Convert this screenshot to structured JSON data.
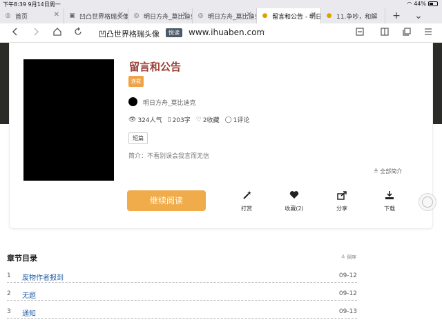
{
  "status": {
    "time": "下午8:39  9月14日周一",
    "battery_pct": "44%"
  },
  "tabs": [
    {
      "label": "首页",
      "icon": "globe-icon",
      "close": "✕"
    },
    {
      "label": "凹凸世界格瑞头像",
      "icon": "image-icon",
      "close": "✕"
    },
    {
      "label": "明日方舟_莫比迪克",
      "icon": "globe-icon",
      "close": "✕"
    },
    {
      "label": "明日方舟_莫比迪克",
      "icon": "globe-icon",
      "close": "✕"
    },
    {
      "label": "留言和公告 - 明日方舟",
      "icon": "lightbulb-icon",
      "close": "✕"
    },
    {
      "label": "11.争吵，和解",
      "icon": "lightbulb-icon",
      "close": "✕"
    }
  ],
  "tab_tools": {
    "add": "+",
    "menu": "⌄"
  },
  "address": {
    "site_title": "凹凸世界格瑞头像",
    "reader_badge": "悦读",
    "url": "www.ihuaben.com"
  },
  "book": {
    "title": "留言和公告",
    "status_tag": "连载",
    "author": "明日方舟_莫比迪克",
    "stats": {
      "popularity": "324人气",
      "words": "203字",
      "favorites": "2收藏",
      "comments": "1评论"
    },
    "genre": "短篇",
    "intro": "简介：不看别误会我言而无信",
    "expand_label": "全部简介",
    "read_button": "继续阅读",
    "actions": [
      {
        "label": "打赏",
        "icon": "magic-wand-icon"
      },
      {
        "label": "收藏(2)",
        "icon": "heart-icon"
      },
      {
        "label": "分享",
        "icon": "share-icon"
      },
      {
        "label": "下载",
        "icon": "download-icon"
      }
    ]
  },
  "chapters": {
    "heading": "章节目录",
    "sort_label": "倒序",
    "items": [
      {
        "num": "1",
        "title": "废物作者报到",
        "date": "09-12"
      },
      {
        "num": "2",
        "title": "无题",
        "date": "09-12"
      },
      {
        "num": "3",
        "title": "通知",
        "date": "09-13"
      }
    ]
  }
}
